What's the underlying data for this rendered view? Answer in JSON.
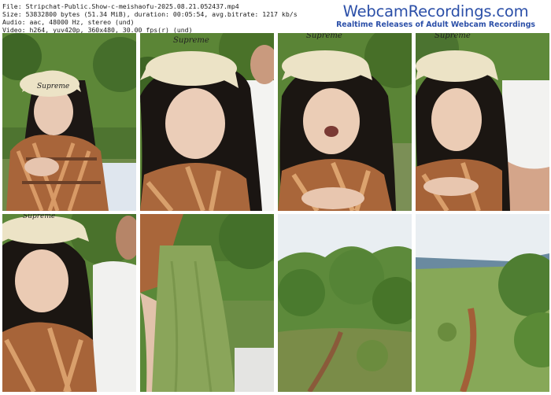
{
  "file_info": {
    "file": "File: Stripchat-Public.Show-c-meishaofu-2025.08.21.052437.mp4",
    "size": "Size: 53832800 bytes (51.34 MiB), duration: 00:05:54, avg.bitrate: 1217 kb/s",
    "audio": "Audio: aac, 48000 Hz, stereo (und)",
    "video": "Video: h264, yuv420p, 360x480, 30.00 fps(r) (und)"
  },
  "brand": {
    "title": "WebcamRecordings.com",
    "tagline": "Realtime Releases of Adult Webcam Recordings"
  },
  "thumbnails": [
    {
      "scene": "woman-sitting-outdoors",
      "cap_text": "Supreme"
    },
    {
      "scene": "woman-closeup-with-man",
      "cap_text": "Supreme"
    },
    {
      "scene": "woman-talking",
      "cap_text": "Supreme"
    },
    {
      "scene": "woman-with-man-arm",
      "cap_text": "Supreme"
    },
    {
      "scene": "woman-and-man-in-white",
      "cap_text": "Supreme"
    },
    {
      "scene": "green-garment-closeup",
      "cap_text": ""
    },
    {
      "scene": "grassy-hillside",
      "cap_text": ""
    },
    {
      "scene": "open-meadow-path",
      "cap_text": ""
    }
  ],
  "colors": {
    "brand_blue": "#2b4fa8",
    "foliage": "#4f7a32",
    "plaid_orange": "#b5683a",
    "cap_cream": "#ece3c6",
    "sky": "#e9eef2"
  }
}
